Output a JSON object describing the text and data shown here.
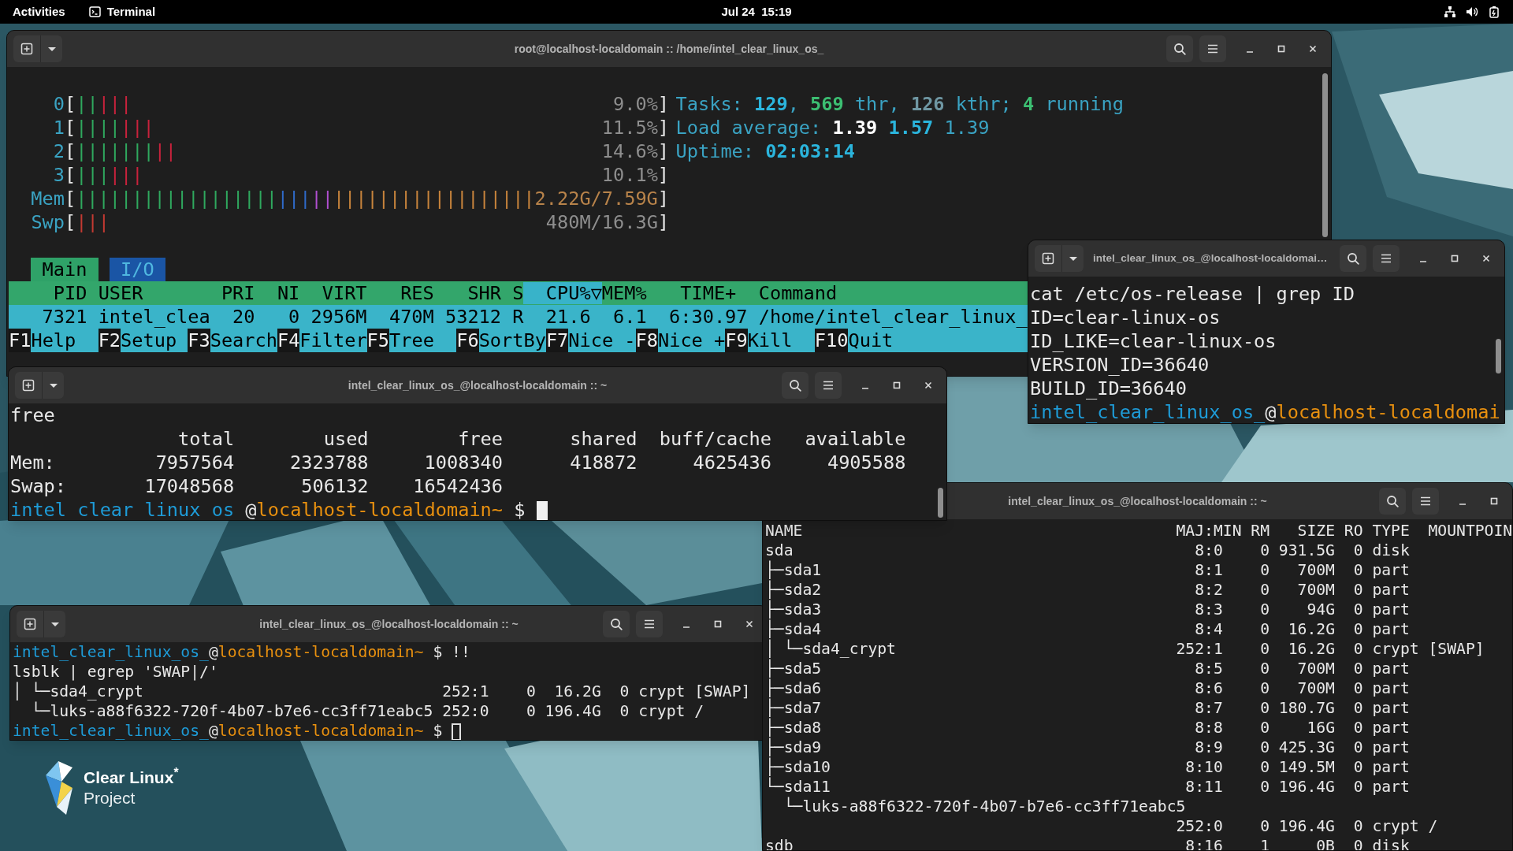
{
  "top_bar": {
    "activities": "Activities",
    "app_menu": "Terminal",
    "clock": "Jul 24  15:19"
  },
  "windows": [
    {
      "kind": "htop",
      "title": "root@localhost-localdomain :: /home/intel_clear_linux_os_",
      "buttons": [
        {
          "kind": "search"
        },
        {
          "kind": "menu"
        },
        {
          "kind": "minimize"
        },
        {
          "kind": "maximize"
        },
        {
          "kind": "close"
        }
      ],
      "scrollbar": {
        "kind": "top"
      },
      "lines": [
        {
          "kind": "meter",
          "label": [
            {
              "text": "0",
              "color": "#3aa3c3"
            },
            {
              "text": "["
            }
          ],
          "bars": [
            {
              "text": "||",
              "color": "#2fa85e"
            },
            {
              "text": "|||",
              "color": "#c8223c"
            }
          ],
          "reading": [
            {
              "text": "9.0%",
              "color": "#8e8e8e"
            },
            {
              "text": "]"
            }
          ],
          "right": [
            {
              "text": "Tasks: ",
              "color": "#3aa3c3"
            },
            {
              "text": "129",
              "color": "#2bb5dd",
              "bold": true
            },
            {
              "text": ", ",
              "color": "#3aa3c3"
            },
            {
              "text": "569",
              "color": "#3cbf72",
              "bold": true
            },
            {
              "text": " thr, ",
              "color": "#3aa3c3"
            },
            {
              "text": "126",
              "color": "#6f97a3",
              "bold": true
            },
            {
              "text": " kthr; ",
              "color": "#3aa3c3"
            },
            {
              "text": "4",
              "color": "#3cbf72",
              "bold": true
            },
            {
              "text": " running",
              "color": "#3aa3c3"
            }
          ]
        },
        {
          "kind": "meter",
          "label": [
            {
              "text": "1",
              "color": "#3aa3c3"
            },
            {
              "text": "["
            }
          ],
          "bars": [
            {
              "text": "||||",
              "color": "#2fa85e"
            },
            {
              "text": "|||",
              "color": "#c8223c"
            }
          ],
          "reading": [
            {
              "text": "11.5%",
              "color": "#8e8e8e"
            },
            {
              "text": "]"
            }
          ],
          "right": [
            {
              "text": "Load average: ",
              "color": "#3aa3c3"
            },
            {
              "text": "1.39 ",
              "color": "#ffffff",
              "bold": true
            },
            {
              "text": "1.57 ",
              "color": "#2bb5dd",
              "bold": true
            },
            {
              "text": "1.39",
              "color": "#3aa3c3"
            }
          ]
        },
        {
          "kind": "meter",
          "label": [
            {
              "text": "2",
              "color": "#3aa3c3"
            },
            {
              "text": "["
            }
          ],
          "bars": [
            {
              "text": "|||||||",
              "color": "#2fa85e"
            },
            {
              "text": "||",
              "color": "#c8223c"
            }
          ],
          "reading": [
            {
              "text": "14.6%",
              "color": "#8e8e8e"
            },
            {
              "text": "]"
            }
          ],
          "right": [
            {
              "text": "Uptime: ",
              "color": "#3aa3c3"
            },
            {
              "text": "02:03:14",
              "color": "#2bb5dd",
              "bold": true
            }
          ]
        },
        {
          "kind": "meter",
          "label": [
            {
              "text": "3",
              "color": "#3aa3c3"
            },
            {
              "text": "["
            }
          ],
          "bars": [
            {
              "text": "|||",
              "color": "#2fa85e"
            },
            {
              "text": "|||",
              "color": "#c8223c"
            }
          ],
          "reading": [
            {
              "text": "10.1%",
              "color": "#8e8e8e"
            },
            {
              "text": "]"
            }
          ]
        },
        {
          "kind": "meter",
          "label": [
            {
              "text": "Mem",
              "color": "#3aa3c3"
            },
            {
              "text": "["
            }
          ],
          "bars": [
            {
              "text": "||||||||||||||||||",
              "color": "#2fa85e"
            },
            {
              "text": "|||",
              "color": "#2f6ac9"
            },
            {
              "text": "||",
              "color": "#b04fd0"
            },
            {
              "text": "||||||||||||||||||",
              "color": "#c8843c"
            }
          ],
          "reading": [
            {
              "text": "2.22G/7.59G",
              "color": "#b8834a"
            },
            {
              "text": "]"
            }
          ]
        },
        {
          "kind": "meter",
          "label": [
            {
              "text": "Swp",
              "color": "#3aa3c3"
            },
            {
              "text": "["
            }
          ],
          "bars": [
            {
              "text": "|||",
              "color": "#c43a32"
            }
          ],
          "reading": [
            {
              "text": "480M/16.3G",
              "color": "#8e8e8e"
            },
            {
              "text": "]"
            }
          ]
        },
        {
          "kind": "tabs",
          "tabs": [
            {
              "label": "Main",
              "selected": true
            },
            {
              "label": "I/O",
              "selected": false
            }
          ]
        },
        {
          "kind": "header",
          "segments": [
            {
              "text": "    PID USER       PRI  NI  VIRT   RES   SHR S"
            },
            {
              "text": "  CPU%▽",
              "selected": true
            },
            {
              "text": "MEM%   TIME+  Command"
            }
          ]
        },
        {
          "kind": "row",
          "text": "   7321 intel_clea  20   0 2956M  470M 53212 R  21.6  6.1  6:30.97 /home/intel_clear_linux_",
          "selected": true
        },
        {
          "kind": "keys",
          "keys": [
            {
              "key": "F1",
              "label": "Help"
            },
            {
              "key": "F2",
              "label": "Setup"
            },
            {
              "key": "F3",
              "label": "Search"
            },
            {
              "key": "F4",
              "label": "Filter"
            },
            {
              "key": "F5",
              "label": "Tree"
            },
            {
              "key": "F6",
              "label": "SortBy"
            },
            {
              "key": "F7",
              "label": "Nice -"
            },
            {
              "key": "F8",
              "label": "Nice +"
            },
            {
              "key": "F9",
              "label": "Kill"
            },
            {
              "key": "F10",
              "label": "Quit"
            }
          ]
        }
      ]
    },
    {
      "kind": "terminal",
      "title": "intel_clear_linux_os_@localhost-localdomai…",
      "buttons": [
        {
          "kind": "search"
        },
        {
          "kind": "menu"
        },
        {
          "kind": "minimize"
        },
        {
          "kind": "maximize"
        },
        {
          "kind": "close"
        }
      ],
      "scrollbar": {
        "kind": "middle"
      },
      "lines": [
        "cat /etc/os-release | grep ID",
        "ID=clear-linux-os",
        "ID_LIKE=clear-linux-os",
        "VERSION_ID=36640",
        "BUILD_ID=36640",
        {
          "kind": "prompt",
          "segments": [
            {
              "text": "intel_clear_linux_os_",
              "color": "#1e9bd7"
            },
            {
              "text": "@"
            },
            {
              "text": "localhost-localdomai",
              "color": "#e8900f"
            }
          ]
        }
      ]
    },
    {
      "kind": "terminal",
      "title": "intel_clear_linux_os_@localhost-localdomain :: ~",
      "buttons": [
        {
          "kind": "search"
        },
        {
          "kind": "menu"
        },
        {
          "kind": "minimize"
        },
        {
          "kind": "maximize"
        },
        {
          "kind": "close"
        }
      ],
      "scrollbar": {
        "kind": "bottom"
      },
      "lines": [
        "free",
        "               total        used        free      shared  buff/cache   available",
        "Mem:         7957564     2323788     1008340      418872     4625436     4905588",
        "Swap:       17048568      506132    16542436",
        {
          "kind": "prompt",
          "segments": [
            {
              "text": "intel_clear_linux_os_",
              "color": "#1e9bd7"
            },
            {
              "text": "@"
            },
            {
              "text": "localhost-localdomain~",
              "color": "#e8900f"
            },
            {
              "text": " $"
            }
          ],
          "cursor": {
            "kind": "filled"
          }
        }
      ]
    },
    {
      "kind": "lsblk",
      "title": "intel_clear_linux_os_@localhost-localdomain :: ~",
      "buttons": [
        {
          "kind": "search"
        },
        {
          "kind": "menu"
        },
        {
          "kind": "minimize"
        },
        {
          "kind": "maximize"
        }
      ],
      "table": {
        "columns": {
          "name": "NAME",
          "maj_min": "MAJ:MIN",
          "rm": "RM",
          "size": "SIZE",
          "ro": "RO",
          "type": "TYPE",
          "mountpoint": "MOUNTPOIN"
        },
        "rows": [
          {
            "name": "sda",
            "maj_min": "8:0",
            "rm": "0",
            "size": "931.5G",
            "ro": "0",
            "type": "disk"
          },
          {
            "name": "├─sda1",
            "maj_min": "8:1",
            "rm": "0",
            "size": "700M",
            "ro": "0",
            "type": "part"
          },
          {
            "name": "├─sda2",
            "maj_min": "8:2",
            "rm": "0",
            "size": "700M",
            "ro": "0",
            "type": "part"
          },
          {
            "name": "├─sda3",
            "maj_min": "8:3",
            "rm": "0",
            "size": "94G",
            "ro": "0",
            "type": "part"
          },
          {
            "name": "├─sda4",
            "maj_min": "8:4",
            "rm": "0",
            "size": "16.2G",
            "ro": "0",
            "type": "part"
          },
          {
            "name": "│ └─sda4_crypt",
            "maj_min": "252:1",
            "rm": "0",
            "size": "16.2G",
            "ro": "0",
            "type": "crypt",
            "mountpoint": "[SWAP]"
          },
          {
            "name": "├─sda5",
            "maj_min": "8:5",
            "rm": "0",
            "size": "700M",
            "ro": "0",
            "type": "part"
          },
          {
            "name": "├─sda6",
            "maj_min": "8:6",
            "rm": "0",
            "size": "700M",
            "ro": "0",
            "type": "part"
          },
          {
            "name": "├─sda7",
            "maj_min": "8:7",
            "rm": "0",
            "size": "180.7G",
            "ro": "0",
            "type": "part"
          },
          {
            "name": "├─sda8",
            "maj_min": "8:8",
            "rm": "0",
            "size": "16G",
            "ro": "0",
            "type": "part"
          },
          {
            "name": "├─sda9",
            "maj_min": "8:9",
            "rm": "0",
            "size": "425.3G",
            "ro": "0",
            "type": "part"
          },
          {
            "name": "├─sda10",
            "maj_min": "8:10",
            "rm": "0",
            "size": "149.5M",
            "ro": "0",
            "type": "part"
          },
          {
            "name": "└─sda11",
            "maj_min": "8:11",
            "rm": "0",
            "size": "196.4G",
            "ro": "0",
            "type": "part"
          },
          {
            "name": "  └─luks-a88f6322-720f-4b07-b7e6-cc3ff71eabc5"
          },
          {
            "maj_min": "252:0",
            "rm": "0",
            "size": "196.4G",
            "ro": "0",
            "type": "crypt",
            "mountpoint": "/"
          },
          {
            "name": "sdb",
            "maj_min": "8:16",
            "rm": "1",
            "size": "0B",
            "ro": "0",
            "type": "disk"
          }
        ]
      }
    },
    {
      "kind": "terminal",
      "title": "intel_clear_linux_os_@localhost-localdomain :: ~",
      "buttons": [
        {
          "kind": "search"
        },
        {
          "kind": "menu"
        },
        {
          "kind": "minimize"
        },
        {
          "kind": "maximize"
        },
        {
          "kind": "close"
        }
      ],
      "lines": [
        {
          "kind": "prompt",
          "segments": [
            {
              "text": "intel_clear_linux_os_",
              "color": "#1e9bd7"
            },
            {
              "text": "@"
            },
            {
              "text": "localhost-localdomain~",
              "color": "#e8900f"
            },
            {
              "text": " $ !!"
            }
          ]
        },
        "lsblk | egrep 'SWAP|/'",
        "│ └─sda4_crypt                                252:1    0  16.2G  0 crypt [SWAP]",
        "  └─luks-a88f6322-720f-4b07-b7e6-cc3ff71eabc5 252:0    0 196.4G  0 crypt /",
        {
          "kind": "prompt",
          "segments": [
            {
              "text": "intel_clear_linux_os_",
              "color": "#1e9bd7"
            },
            {
              "text": "@"
            },
            {
              "text": "localhost-localdomain~",
              "color": "#e8900f"
            },
            {
              "text": " $"
            }
          ],
          "cursor": {
            "kind": "outline"
          }
        }
      ]
    }
  ],
  "desktop_logo": {
    "title": "Clear Linux$^{*}$",
    "subtitle": "Project"
  }
}
